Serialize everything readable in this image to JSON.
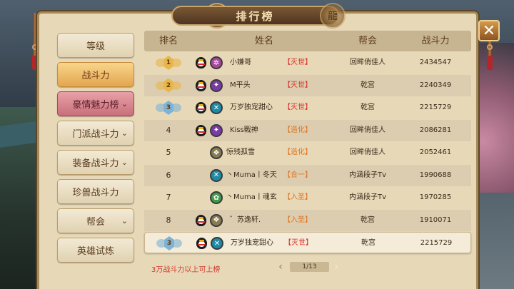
{
  "window": {
    "title": "排行榜",
    "close_label": "✕"
  },
  "sidebar": {
    "items": [
      {
        "label": "等级",
        "state": "normal",
        "has_chevron": false
      },
      {
        "label": "战斗力",
        "state": "active",
        "has_chevron": false
      },
      {
        "label": "豪情魅力榜",
        "state": "highlight",
        "has_chevron": true
      },
      {
        "label": "门派战斗力",
        "state": "normal",
        "has_chevron": true
      },
      {
        "label": "装备战斗力",
        "state": "normal",
        "has_chevron": true
      },
      {
        "label": "珍兽战斗力",
        "state": "normal",
        "has_chevron": false
      },
      {
        "label": "帮会",
        "state": "normal",
        "has_chevron": true
      },
      {
        "label": "英雄试炼",
        "state": "normal",
        "has_chevron": false
      }
    ]
  },
  "table": {
    "headers": [
      "排名",
      "姓名",
      "帮会",
      "战斗力"
    ],
    "rows": [
      {
        "rank": "1",
        "badge": "gold",
        "qq": true,
        "sect_color": "#a8489a",
        "sect_icon": "gear-icon",
        "name": "小嫌哥",
        "tag": "【灭世】",
        "tag_color": "red",
        "guild": "回眸俏佳人",
        "power": "2434547"
      },
      {
        "rank": "2",
        "badge": "gold",
        "qq": true,
        "sect_color": "#7a3aa6",
        "sect_icon": "star-icon",
        "name": "M平头",
        "tag": "【灭世】",
        "tag_color": "red",
        "guild": "乾宫",
        "power": "2240349"
      },
      {
        "rank": "3",
        "badge": "blue",
        "qq": true,
        "sect_color": "#1d8aa6",
        "sect_icon": "cross-icon",
        "name": "万岁独宠甜心",
        "tag": "【灭世】",
        "tag_color": "red",
        "guild": "乾宫",
        "power": "2215729"
      },
      {
        "rank": "4",
        "badge": "",
        "qq": true,
        "sect_color": "#7a3aa6",
        "sect_icon": "star-icon",
        "name": "Kiss戰神",
        "tag": "【造化】",
        "tag_color": "orange",
        "guild": "回眸俏佳人",
        "power": "2086281"
      },
      {
        "rank": "5",
        "badge": "",
        "qq": false,
        "sect_color": "#8a7a50",
        "sect_icon": "shield-icon",
        "name": "惊残孤雪",
        "tag": "【造化】",
        "tag_color": "orange",
        "guild": "回眸俏佳人",
        "power": "2052461"
      },
      {
        "rank": "6",
        "badge": "",
        "qq": false,
        "sect_color": "#1d8aa6",
        "sect_icon": "cross-icon",
        "name": "丶Muma丨冬天",
        "tag": "【合一】",
        "tag_color": "orange",
        "guild": "内涵段子Tv",
        "power": "1990688"
      },
      {
        "rank": "7",
        "badge": "",
        "qq": false,
        "sect_color": "#3f9a4a",
        "sect_icon": "leaf-icon",
        "name": "丶Muma丨魂玄",
        "tag": "【入圣】",
        "tag_color": "orange",
        "guild": "内涵段子Tv",
        "power": "1970285"
      },
      {
        "rank": "8",
        "badge": "",
        "qq": true,
        "sect_color": "#8a7a50",
        "sect_icon": "shield-icon",
        "name": "゛苏逸轩.",
        "tag": "【入圣】",
        "tag_color": "orange",
        "guild": "乾宫",
        "power": "1910071"
      }
    ],
    "self_row": {
      "rank": "3",
      "badge": "blue",
      "qq": true,
      "sect_color": "#1d8aa6",
      "sect_icon": "cross-icon",
      "name": "万岁独宠甜心",
      "tag": "【灭世】",
      "tag_color": "red",
      "guild": "乾宫",
      "power": "2215729"
    }
  },
  "footer": {
    "note": "3万战斗力以上可上榜",
    "page": "1/13",
    "prev_arrow": "‹",
    "next_arrow": "›"
  },
  "colors": {
    "gold": "#e8b64a",
    "blue": "#7fb3d6",
    "red": "#d8322a",
    "orange": "#e07420"
  }
}
